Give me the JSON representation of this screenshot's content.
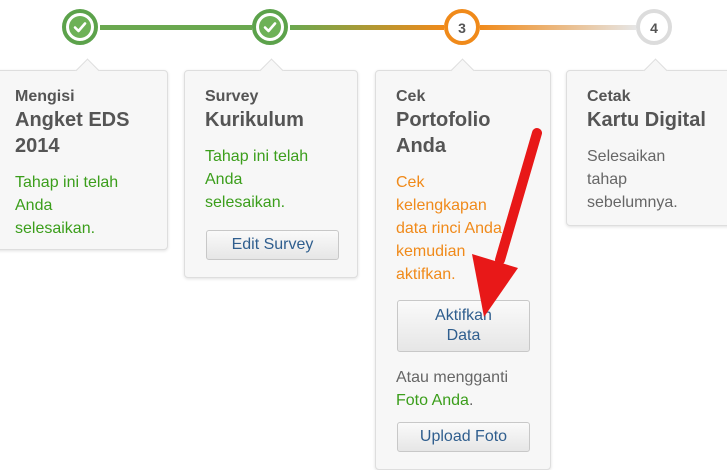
{
  "steps": [
    {
      "status": "done",
      "marker": "check-icon"
    },
    {
      "status": "done",
      "marker": "check-icon"
    },
    {
      "status": "active",
      "number": "3"
    },
    {
      "status": "pending",
      "number": "4"
    }
  ],
  "colors": {
    "done": "#5ca24b",
    "active": "#f08a1a",
    "pending": "#dcdcdc",
    "green_text": "#3b9e1b",
    "orange_text": "#f08a1a",
    "button_text": "#2f5e8e",
    "arrow": "#e81818"
  },
  "cards": [
    {
      "pre": "Mengisi",
      "title_lines": [
        "Angket EDS",
        "2014"
      ],
      "message_lines": [
        "Tahap ini telah",
        "Anda",
        "selesaikan."
      ]
    },
    {
      "pre": "Survey",
      "title_lines": [
        "Kurikulum"
      ],
      "message_lines": [
        "Tahap ini telah",
        "Anda",
        "selesaikan."
      ],
      "button": "Edit Survey"
    },
    {
      "pre": "Cek",
      "title_lines": [
        "Portofolio",
        "Anda"
      ],
      "message_lines": [
        "Cek",
        "kelengkapan",
        "data rinci Anda",
        "kemudian",
        "aktifkan."
      ],
      "button_lines": [
        "Aktifkan",
        "Data"
      ],
      "alt_lines": [
        "Atau mengganti"
      ],
      "alt_green": "Foto Anda",
      "alt_suffix": ".",
      "button2": "Upload Foto"
    },
    {
      "pre": "Cetak",
      "title_lines": [
        "Kartu Digital"
      ],
      "message_lines": [
        "Selesaikan",
        "tahap",
        "sebelumnya."
      ]
    }
  ]
}
